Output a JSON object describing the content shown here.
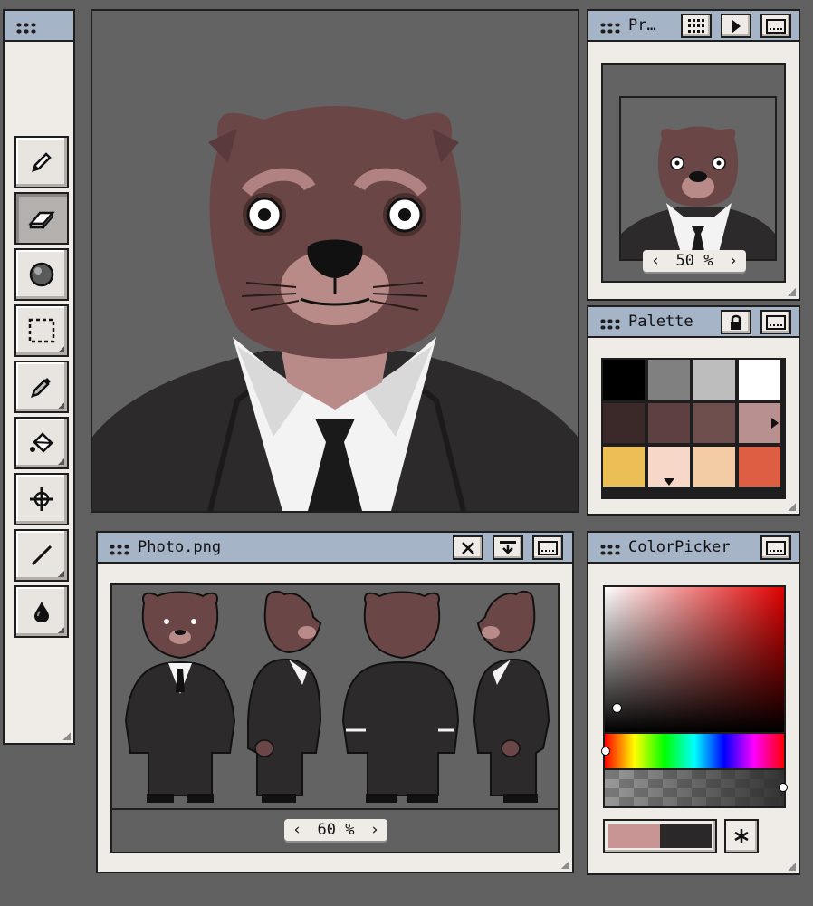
{
  "preview": {
    "title": "Pr…",
    "zoom": "50 %"
  },
  "palette": {
    "title": "Palette",
    "swatches": [
      "#000000",
      "#808080",
      "#bdbdbd",
      "#ffffff",
      "#3a2928",
      "#5d403f",
      "#6e4d4d",
      "#b99090",
      "#ebbf55",
      "#f7d7c8",
      "#f3cba5",
      "#dd5e43"
    ]
  },
  "photo": {
    "title": "Photo.png",
    "zoom": "60 %"
  },
  "colorpicker": {
    "title": "ColorPicker",
    "primary": "#c89494",
    "secondary": "#2b2829"
  },
  "tools": [
    "pencil-tool",
    "eraser-tool",
    "shading-tool",
    "selection-tool",
    "eyedropper-tool",
    "fill-tool",
    "move-tool",
    "line-tool",
    "ink-tool"
  ],
  "colors": {
    "suit": "#2c2a2b",
    "fur": "#6a4646",
    "muzzle": "#b98b88",
    "shirt": "#f3f3f3",
    "titlebar": "#a6b4c8"
  }
}
